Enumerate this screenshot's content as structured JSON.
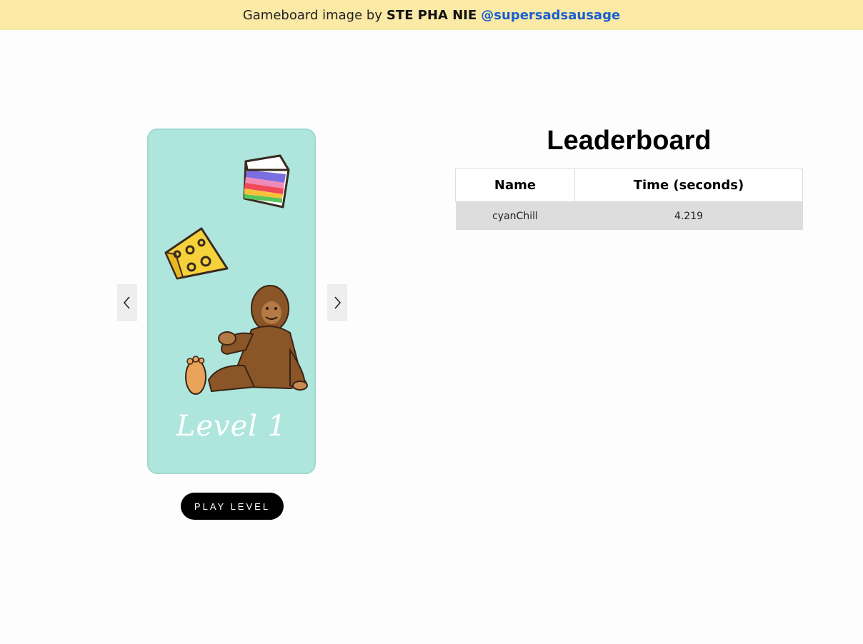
{
  "banner": {
    "prefix": "Gameboard image by",
    "artist": "STE PHA NIE",
    "handle": "@supersadsausage"
  },
  "level_card": {
    "label": "Level 1",
    "background_color": "#aee6dd",
    "items": [
      "rainbow-cake-icon",
      "cheese-icon",
      "bigfoot-icon"
    ]
  },
  "nav": {
    "prev_icon": "chevron-left-icon",
    "next_icon": "chevron-right-icon"
  },
  "play_button": {
    "label": "PLAY LEVEL"
  },
  "leaderboard": {
    "title": "Leaderboard",
    "columns": [
      "Name",
      "Time (seconds)"
    ],
    "rows": [
      {
        "name": "cyanChill",
        "time": "4.219"
      }
    ]
  }
}
